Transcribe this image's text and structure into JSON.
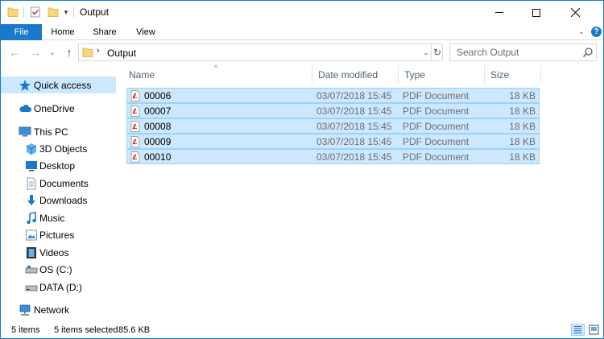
{
  "window": {
    "title": "Output"
  },
  "ribbon": {
    "tabs": {
      "file": "File",
      "home": "Home",
      "share": "Share",
      "view": "View"
    },
    "help": "?"
  },
  "address": {
    "crumb_sep": "›",
    "path": "Output"
  },
  "search": {
    "placeholder": "Search Output",
    "value": ""
  },
  "nav_pane": {
    "items": [
      {
        "label": "Quick access",
        "icon": "star-icon"
      },
      {
        "label": "OneDrive",
        "icon": "cloud-icon"
      },
      {
        "label": "This PC",
        "icon": "computer-icon"
      },
      {
        "label": "3D Objects",
        "icon": "cube-icon"
      },
      {
        "label": "Desktop",
        "icon": "desktop-icon"
      },
      {
        "label": "Documents",
        "icon": "document-icon"
      },
      {
        "label": "Downloads",
        "icon": "download-icon"
      },
      {
        "label": "Music",
        "icon": "music-icon"
      },
      {
        "label": "Pictures",
        "icon": "pictures-icon"
      },
      {
        "label": "Videos",
        "icon": "video-icon"
      },
      {
        "label": "OS (C:)",
        "icon": "drive-icon"
      },
      {
        "label": "DATA (D:)",
        "icon": "drive-icon"
      },
      {
        "label": "Network",
        "icon": "network-icon"
      }
    ]
  },
  "columns": {
    "name": "Name",
    "date": "Date modified",
    "type": "Type",
    "size": "Size"
  },
  "files": [
    {
      "name": "00006",
      "date": "03/07/2018 15:45",
      "type": "PDF Document",
      "size": "18 KB"
    },
    {
      "name": "00007",
      "date": "03/07/2018 15:45",
      "type": "PDF Document",
      "size": "18 KB"
    },
    {
      "name": "00008",
      "date": "03/07/2018 15:45",
      "type": "PDF Document",
      "size": "18 KB"
    },
    {
      "name": "00009",
      "date": "03/07/2018 15:45",
      "type": "PDF Document",
      "size": "18 KB"
    },
    {
      "name": "00010",
      "date": "03/07/2018 15:45",
      "type": "PDF Document",
      "size": "18 KB"
    }
  ],
  "status": {
    "count": "5 items",
    "selected": "5 items selected",
    "size": "85.6 KB"
  },
  "colors": {
    "accent": "#1979ca",
    "selection": "#cce8ff",
    "selection_border": "#99d1ff",
    "folder": "#f8d775",
    "pdf_red": "#d0281f"
  }
}
